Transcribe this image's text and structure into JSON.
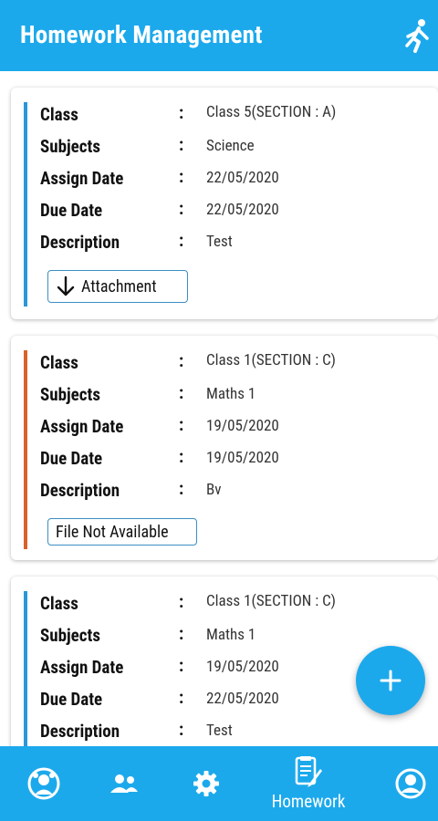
{
  "app": {
    "title": "Homework Management"
  },
  "icons": {
    "logout": "runner-exit-icon",
    "add": "plus-icon",
    "attachment": "download-arrow-icon",
    "nav_dashboard": "kid-face-icon",
    "nav_students": "people-icon",
    "nav_settings": "gear-icon",
    "nav_homework": "document-pen-icon",
    "nav_profile": "profile-icon"
  },
  "colors": {
    "primary": "#1ca9ec",
    "accent_blue": "#2a97d6",
    "accent_orange": "#d9622a"
  },
  "labels": {
    "class": "Class",
    "subjects": "Subjects",
    "assign_date": "Assign Date",
    "due_date": "Due Date",
    "description": "Description",
    "colon": ":"
  },
  "homework": [
    {
      "class": "Class 5(SECTION : A)",
      "subjects": "Science",
      "assign_date": "22/05/2020",
      "due_date": "22/05/2020",
      "description": "Test",
      "button": "Attachment"
    },
    {
      "class": "Class 1(SECTION : C)",
      "subjects": "Maths 1",
      "assign_date": "19/05/2020",
      "due_date": "19/05/2020",
      "description": "Bv",
      "button": "File Not Available"
    },
    {
      "class": "Class 1(SECTION : C)",
      "subjects": "Maths 1",
      "assign_date": "19/05/2020",
      "due_date": "22/05/2020",
      "description": "Test"
    }
  ],
  "nav": {
    "active_label": "Homework"
  }
}
